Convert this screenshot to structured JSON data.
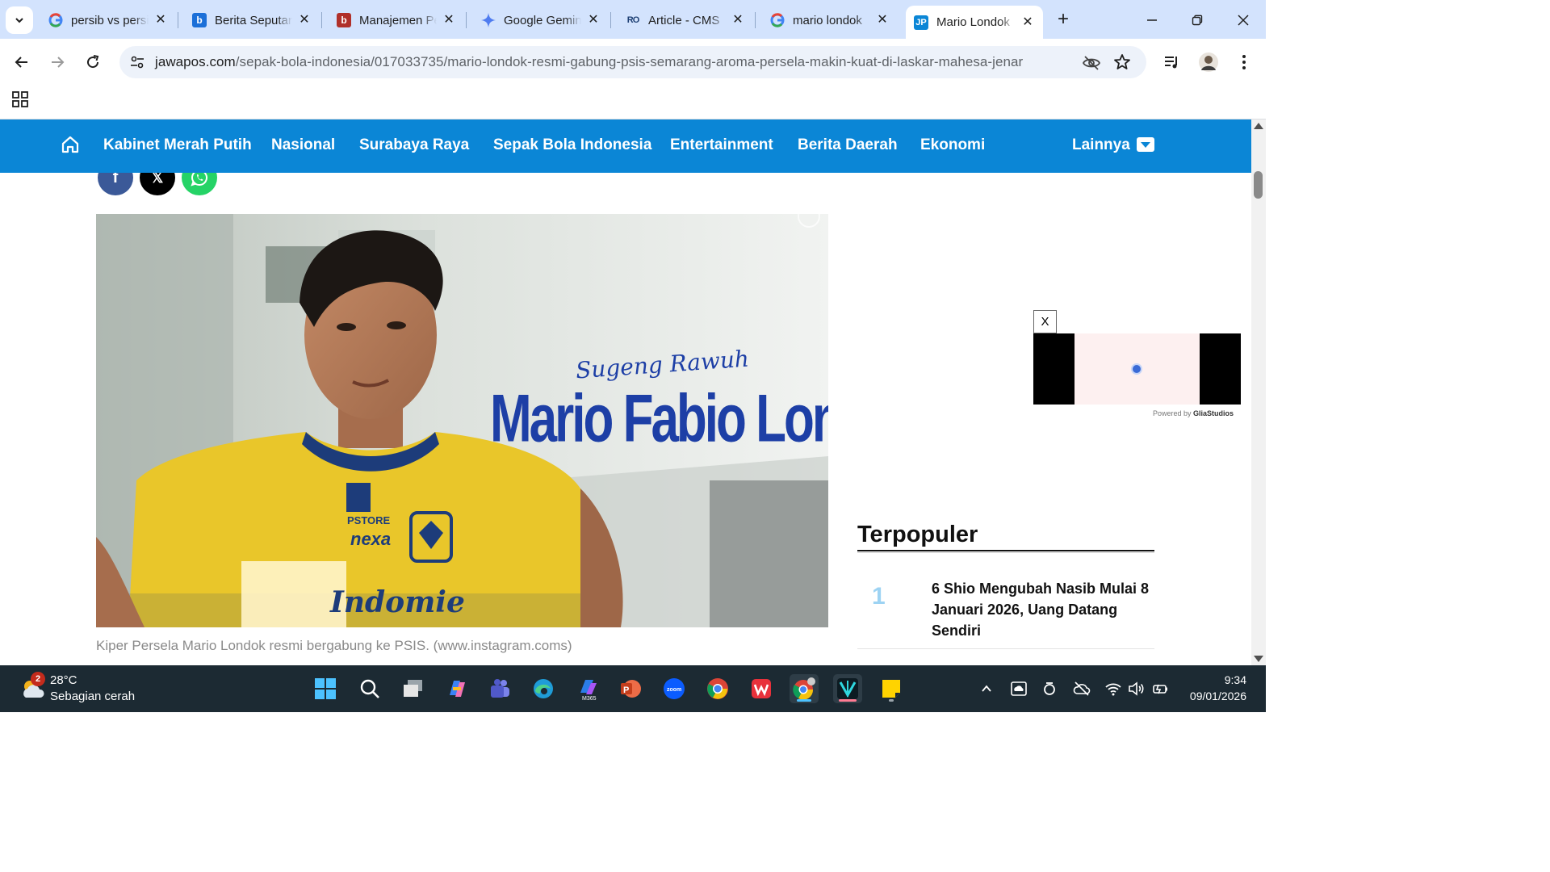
{
  "tabs": [
    {
      "title": "persib vs persi",
      "favicon": "google-icon",
      "active": false
    },
    {
      "title": "Berita Seputar",
      "favicon": "b-icon",
      "active": false
    },
    {
      "title": "Manajemen Pe",
      "favicon": "b-icon",
      "active": false
    },
    {
      "title": "Google Gemin",
      "favicon": "gemini-icon",
      "active": false
    },
    {
      "title": "Article - CMS",
      "favicon": "ro-icon",
      "active": false
    },
    {
      "title": "mario londok",
      "favicon": "google-icon",
      "active": false
    },
    {
      "title": "Mario Londok",
      "favicon": "jp-icon",
      "active": true
    }
  ],
  "favicon_text": {
    "jp": "JP",
    "ro": "RO",
    "b": "b"
  },
  "address": {
    "host": "jawapos.com",
    "path": "/sepak-bola-indonesia/017033735/mario-londok-resmi-gabung-psis-semarang-aroma-persela-makin-kuat-di-laskar-mahesa-jenar"
  },
  "site_nav": {
    "items": [
      "Kabinet Merah Putih",
      "Nasional",
      "Surabaya Raya",
      "Sepak Bola Indonesia",
      "Entertainment",
      "Berita Daerah",
      "Ekonomi"
    ],
    "more": "Lainnya"
  },
  "share": {
    "facebook": "f",
    "x": "𝕏"
  },
  "hero": {
    "script_line": "Sugeng Rawuh",
    "player_name": "Mario Fabio Londok",
    "jersey_sponsor": "Indomie",
    "jersey_text_1": "PSTORE",
    "jersey_text_2": "nexa"
  },
  "caption": "Kiper Persela Mario Londok resmi bergabung ke PSIS. (www.instagram.coms)",
  "ad": {
    "close": "X",
    "powered_prefix": "Powered by ",
    "powered_brand": "GliaStudios"
  },
  "popular": {
    "heading": "Terpopuler",
    "items": [
      {
        "rank": "1",
        "title": "6 Shio Mengubah Nasib Mulai 8 Januari 2026, Uang Datang Sendiri"
      }
    ]
  },
  "taskbar": {
    "weather_badge": "2",
    "temperature": "28°C",
    "condition": "Sebagian cerah",
    "time": "9:34",
    "date": "09/01/2026"
  },
  "colors": {
    "nav_blue": "#0b86d6",
    "title_blue": "#1d3fa6",
    "jersey_yellow": "#e9c62a"
  }
}
